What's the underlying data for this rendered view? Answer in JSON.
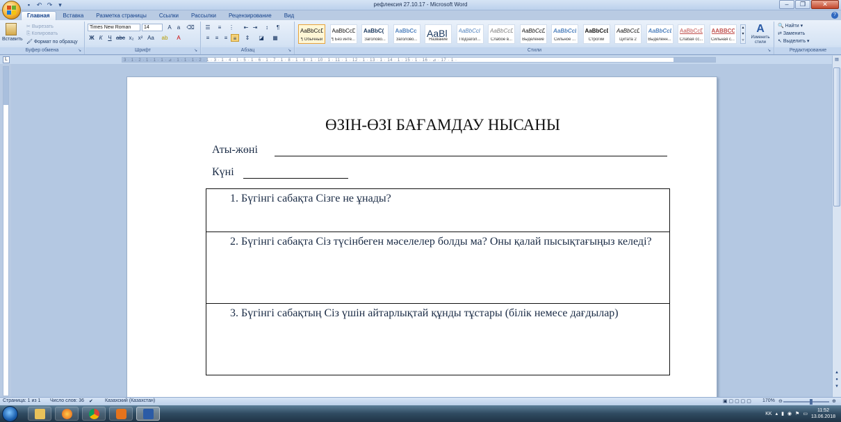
{
  "window": {
    "title": "рефлексия 27.10.17 - Microsoft Word"
  },
  "tabs": [
    "Главная",
    "Вставка",
    "Разметка страницы",
    "Ссылки",
    "Рассылки",
    "Рецензирование",
    "Вид"
  ],
  "ribbon": {
    "clipboard": {
      "paste_label": "Вставить",
      "cut_label": "Вырезать",
      "copy_label": "Копировать",
      "format_painter_label": "Формат по образцу",
      "group_label": "Буфер обмена"
    },
    "font": {
      "font_name": "Times New Roman",
      "font_size": "14",
      "group_label": "Шрифт"
    },
    "paragraph": {
      "group_label": "Абзац"
    },
    "styles": {
      "items": [
        {
          "preview": "AaBbCcDc",
          "name": "¶ Обычный",
          "selected": true
        },
        {
          "preview": "AaBbCcDc",
          "name": "¶ Без инте..."
        },
        {
          "preview": "AaBbC(",
          "name": "Заголово..."
        },
        {
          "preview": "AaBbCc",
          "name": "Заголово..."
        },
        {
          "preview": "AaBl",
          "name": "Название"
        },
        {
          "preview": "AaBbCcl",
          "name": "Подзагол..."
        },
        {
          "preview": "AaBbCcDi",
          "name": "Слабое в..."
        },
        {
          "preview": "AaBbCcDi",
          "name": "Выделение"
        },
        {
          "preview": "AaBbCcDi",
          "name": "Сильное ..."
        },
        {
          "preview": "AaBbCcDc",
          "name": "Строгий"
        },
        {
          "preview": "AaBbCcDi",
          "name": "Цитата 2"
        },
        {
          "preview": "AaBbCcDi",
          "name": "Выделенн..."
        },
        {
          "preview": "AaBbCcDc",
          "name": "Слабая сс..."
        },
        {
          "preview": "AABBCCDE",
          "name": "Сильная с..."
        }
      ],
      "change_styles_label": "Изменить стили",
      "group_label": "Стили"
    },
    "editing": {
      "find_label": "Найти",
      "replace_label": "Заменить",
      "select_label": "Выделить",
      "group_label": "Редактирование"
    }
  },
  "document": {
    "title": "ӨЗІН-ӨЗІ БАҒАМДАУ НЫСАНЫ",
    "name_label": "Аты-жөні",
    "date_label": "Күні",
    "questions": [
      "1.  Бүгінгі сабақта Сізге не ұнады?",
      "2. Бүгінгі сабақта Сіз түсінбеген мәселелер болды ма? Оны қалай пысықтағыңыз келеді?",
      "3. Бүгінгі сабақтың Сіз үшін айтарлықтай құнды тұстары (білік немесе дағдылар)"
    ]
  },
  "ruler": {
    "ticks": "3 · 1 · 2 · 1 · 1 · 1 · ⊿ · 1 · 1 · 1 · 2 · 1 · 3 · 1 · 4 · 1 · 5 · 1 · 6 · 1 · 7 · 1 · 8 · 1 · 9 · 1 · 10 · 1 · 11 · 1 · 12 · 1 · 13 · 1 · 14 · 1 · 15 · 1 · 16 · ⊿ · 17 · 1 ·"
  },
  "statusbar": {
    "page": "Страница: 1 из 1",
    "words": "Число слов: 36",
    "language": "Казахский (Казахстан)",
    "zoom": "170%"
  },
  "taskbar": {
    "lang": "KK",
    "time": "11:52",
    "date": "13.06.2018"
  },
  "colors": {
    "ribbon_bg": "#d5e3f4",
    "canvas_bg": "#b4c8e2",
    "accent": "#15428b"
  }
}
